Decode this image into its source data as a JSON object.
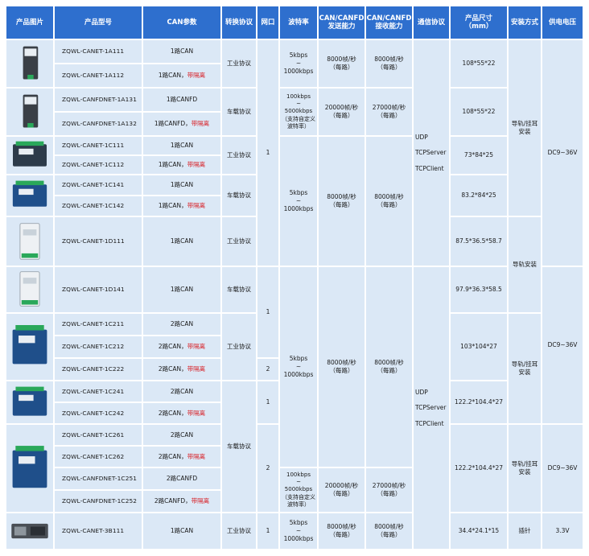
{
  "headers": {
    "image": "产品图片",
    "model": "产品型号",
    "can_params": "CAN参数",
    "protocol": "转换协议",
    "ports": "网口",
    "baud": "波特率",
    "send": "CAN/CANFD\n发送能力",
    "recv": "CAN/CANFD\n接收能力",
    "comm": "通信协议",
    "size": "产品尺寸\n（mm）",
    "install": "安装方式",
    "power": "供电电压"
  },
  "models": [
    "ZQWL-CANET-1A111",
    "ZQWL-CANET-1A112",
    "ZQWL-CANFDNET-1A131",
    "ZQWL-CANFDNET-1A132",
    "ZQWL-CANET-1C111",
    "ZQWL-CANET-1C112",
    "ZQWL-CANET-1C141",
    "ZQWL-CANET-1C142",
    "ZQWL-CANET-1D111",
    "ZQWL-CANET-1D141",
    "ZQWL-CANET-1C211",
    "ZQWL-CANET-1C212",
    "ZQWL-CANET-1C222",
    "ZQWL-CANET-1C241",
    "ZQWL-CANET-1C242",
    "ZQWL-CANET-1C261",
    "ZQWL-CANET-1C262",
    "ZQWL-CANFDNET-1C251",
    "ZQWL-CANFDNET-1C252",
    "ZQWL-CANET-3B111"
  ],
  "params": [
    {
      "main": "1路CAN",
      "iso": ""
    },
    {
      "main": "1路CAN，",
      "iso": "带隔离"
    },
    {
      "main": "1路CANFD",
      "iso": ""
    },
    {
      "main": "1路CANFD，",
      "iso": "带隔离"
    },
    {
      "main": "1路CAN",
      "iso": ""
    },
    {
      "main": "1路CAN，",
      "iso": "带隔离"
    },
    {
      "main": "1路CAN",
      "iso": ""
    },
    {
      "main": "1路CAN，",
      "iso": "带隔离"
    },
    {
      "main": "1路CAN",
      "iso": ""
    },
    {
      "main": "1路CAN",
      "iso": ""
    },
    {
      "main": "2路CAN",
      "iso": ""
    },
    {
      "main": "2路CAN，",
      "iso": "带隔离"
    },
    {
      "main": "2路CAN，",
      "iso": "带隔离"
    },
    {
      "main": "2路CAN",
      "iso": ""
    },
    {
      "main": "2路CAN，",
      "iso": "带隔离"
    },
    {
      "main": "2路CAN",
      "iso": ""
    },
    {
      "main": "2路CAN，",
      "iso": "带隔离"
    },
    {
      "main": "2路CANFD",
      "iso": ""
    },
    {
      "main": "2路CANFD，",
      "iso": "带隔离"
    },
    {
      "main": "1路CAN",
      "iso": ""
    }
  ],
  "protocol": {
    "industrial": "工业协议",
    "vehicle": "车载协议"
  },
  "ports": {
    "one": "1",
    "two": "2"
  },
  "baud": {
    "can": "5kbps\n~\n1000kbps",
    "canfd": "100kbps\n~\n5000kbps\n（支持自定义\n波特率）"
  },
  "send": {
    "can": "8000帧/秒\n（每路）",
    "canfd": "20000帧/秒\n（每路）"
  },
  "recv": {
    "can": "8000帧/秒\n（每路）",
    "canfd": "27000帧/秒\n（每路）"
  },
  "comm": "UDP\nTCPServer\nTCPClient",
  "sizes": {
    "a": "108*55*22",
    "c1": "73*84*25",
    "c14": "83.2*84*25",
    "d1": "87.5*36.5*58.7",
    "d14": "97.9*36.3*58.5",
    "c2": "103*104*27",
    "c24": "122.2*104.4*27",
    "c26": "122.2*104.4*27",
    "b3": "34.4*24.1*15"
  },
  "install": {
    "rail_hang": "导轨/挂耳\n安装",
    "rail": "导轨安装",
    "pin": "插针"
  },
  "power": {
    "dc": "DC9~36V",
    "v33": "3.3V"
  },
  "colors": {
    "header_bg": "#2e6fce",
    "cell_bg": "#dbe8f6",
    "isolation_text": "#d8232a"
  }
}
